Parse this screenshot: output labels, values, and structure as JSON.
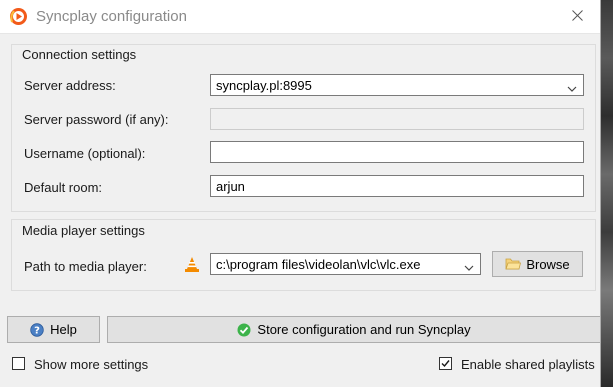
{
  "window": {
    "title": "Syncplay configuration"
  },
  "connection": {
    "group_title": "Connection settings",
    "server_address_label": "Server address:",
    "server_address_value": "syncplay.pl:8995",
    "server_password_label": "Server password (if any):",
    "server_password_value": "",
    "username_label": "Username (optional):",
    "username_value": "",
    "default_room_label": "Default room:",
    "default_room_value": "arjun"
  },
  "media": {
    "group_title": "Media player settings",
    "path_label": "Path to media player:",
    "path_value": "c:\\program files\\videolan\\vlc\\vlc.exe",
    "browse_label": "Browse"
  },
  "actions": {
    "help_label": "Help",
    "store_label": "Store configuration and run Syncplay"
  },
  "footer": {
    "show_more_label": "Show more settings",
    "show_more_checked": false,
    "shared_playlists_label": "Enable shared playlists",
    "shared_playlists_checked": true
  },
  "icons": {
    "app": "syncplay-logo-icon",
    "close": "close-icon",
    "vlc": "vlc-cone-icon",
    "folder": "folder-icon",
    "help": "help-icon",
    "store": "checkmark-icon"
  }
}
